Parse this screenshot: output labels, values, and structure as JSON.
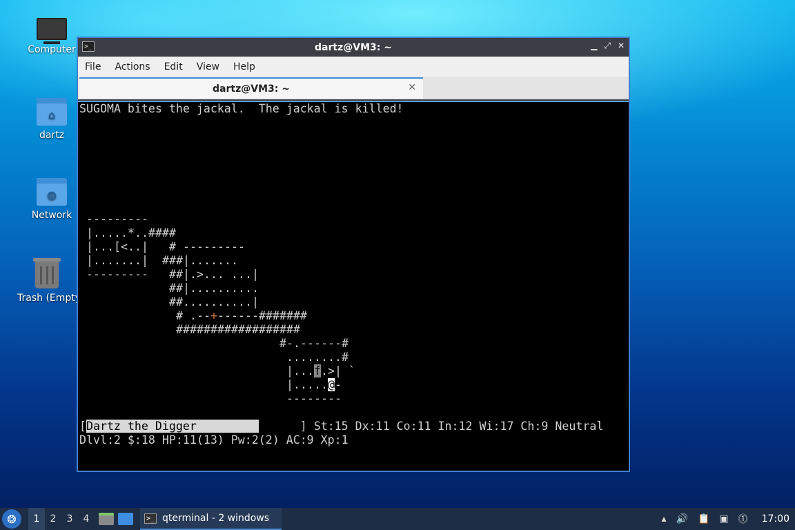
{
  "desktop": {
    "icons": [
      {
        "label": "Computer"
      },
      {
        "label": "dartz"
      },
      {
        "label": "Network"
      },
      {
        "label": "Trash (Empty)"
      }
    ]
  },
  "window": {
    "title": "dartz@VM3: ~",
    "menus": [
      "File",
      "Actions",
      "Edit",
      "View",
      "Help"
    ],
    "tab_title": "dartz@VM3: ~",
    "tab_close": "✕"
  },
  "terminal": {
    "message": "SUGOMA bites the jackal.  The jackal is killed!",
    "map": [
      " ---------",
      " |.....*..####",
      " |...[<..|   # ---------",
      " |.......|  ###|.......",
      " ---------   ##|.>... ...|",
      "             ##|..........",
      "             ##..........|",
      "              # .--+------#######",
      "              ##################",
      "                             #-.------#",
      "                              ........#",
      "                              |...f.>| `",
      "                              |.....@-",
      "                              --------"
    ],
    "status_name": "Dartz the Digger",
    "status_attrs": "] St:15 Dx:11 Co:11 In:12 Wi:17 Ch:9 Neutral",
    "status_line2": "Dlvl:2 $:18 HP:11(13) Pw:2(2) AC:9 Xp:1"
  },
  "taskbar": {
    "workspaces": [
      "1",
      "2",
      "3",
      "4"
    ],
    "task_label": "qterminal - 2 windows",
    "clock": "17:00"
  }
}
